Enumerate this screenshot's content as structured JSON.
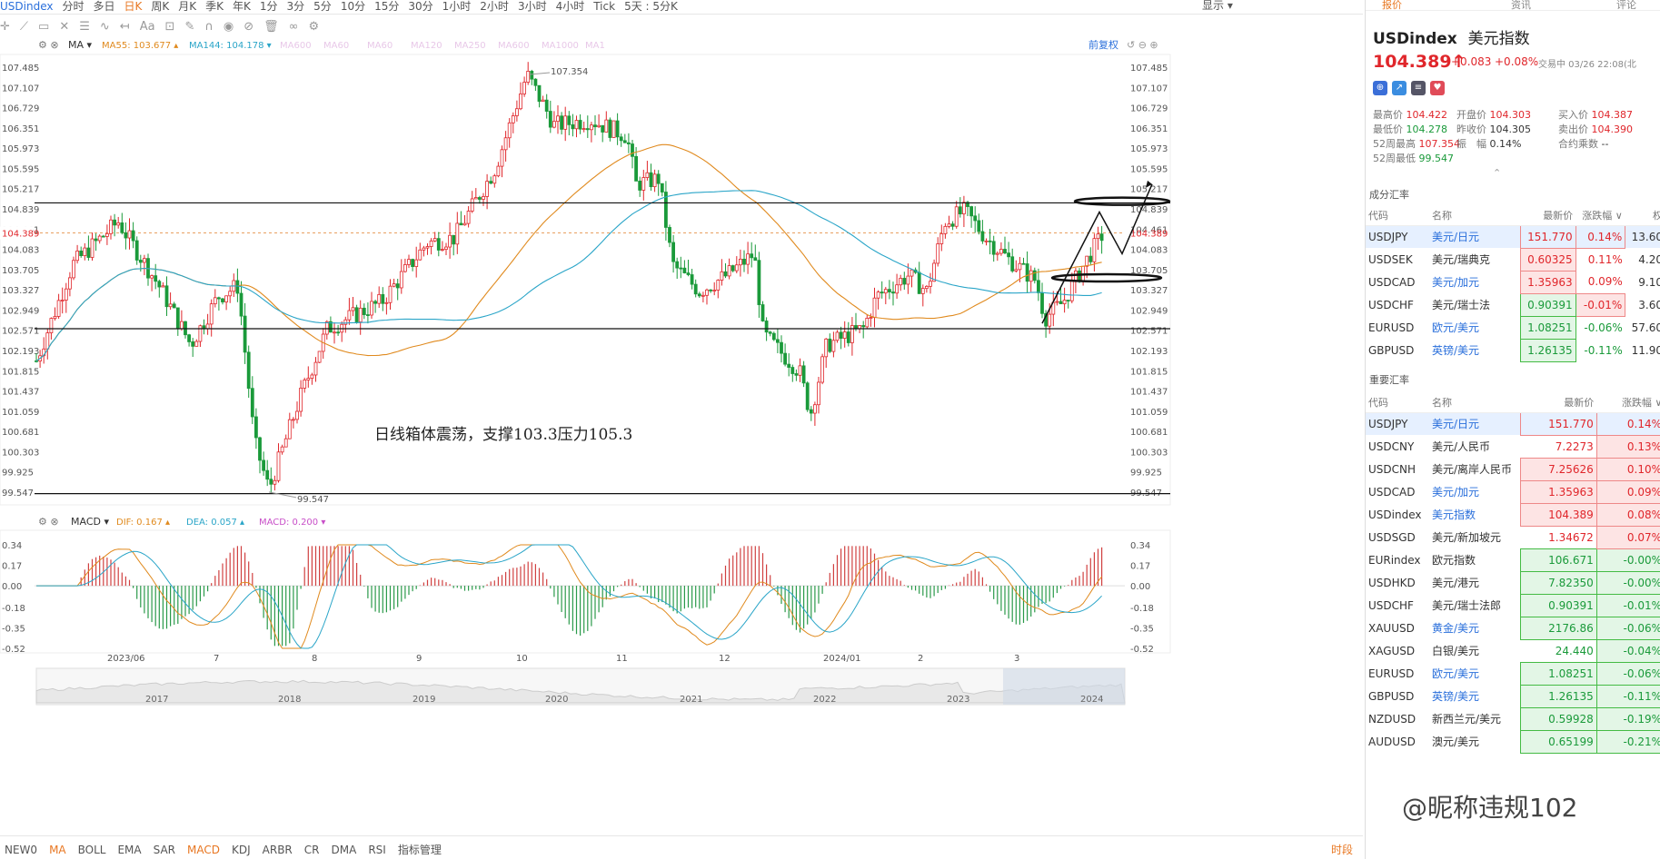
{
  "topbar": {
    "symbol": "USDindex",
    "periods": [
      "分时",
      "多日",
      "日K",
      "周K",
      "月K",
      "季K",
      "年K",
      "1分",
      "3分",
      "5分",
      "10分",
      "15分",
      "30分",
      "1小时",
      "2小时",
      "3小时",
      "4小时",
      "Tick",
      "5天 : 5分K"
    ],
    "active_period": "日K",
    "right": "显示"
  },
  "chart_header": {
    "ma_label": "MA",
    "ma55": "MA55: 103.677",
    "ma144": "MA144: 104.178",
    "faded": [
      "MA600",
      "MA60",
      "MA60",
      "MA120",
      "MA250",
      "MA600",
      "MA1000",
      "MA1"
    ],
    "fuquan": "前复权"
  },
  "macd_header": {
    "label": "MACD",
    "dif": "DIF: 0.167",
    "dea": "DEA: 0.057",
    "macd": "MACD: 0.200"
  },
  "price_axis": [
    "107.485",
    "107.107",
    "106.729",
    "106.351",
    "105.973",
    "105.595",
    "105.217",
    "104.839",
    "104.461",
    "104.083",
    "103.705",
    "103.327",
    "102.949",
    "102.571",
    "102.193",
    "101.815",
    "101.437",
    "101.059",
    "100.681",
    "100.303",
    "99.925",
    "99.547"
  ],
  "current_price": "104.389",
  "macd_axis": [
    "0.34",
    "0.17",
    "0.00",
    "-0.18",
    "-0.35",
    "-0.52"
  ],
  "x_labels": [
    "2023/06",
    "7",
    "8",
    "9",
    "10",
    "11",
    "12",
    "2024/01",
    "2",
    "3"
  ],
  "overview_years": [
    "2017",
    "2018",
    "2019",
    "2020",
    "2021",
    "2022",
    "2023",
    "2024"
  ],
  "high_label": "107.354",
  "low_label": "99.547",
  "annotation": "日线箱体震荡，支撑103.3压力105.3",
  "chart_data": {
    "type": "candlestick",
    "x_range": [
      "2023/05",
      "2024/03"
    ],
    "y_range": [
      99.547,
      107.485
    ],
    "high": 107.354,
    "low": 99.547,
    "current": 104.389,
    "horizontal_lines": [
      104.95,
      102.6,
      99.52
    ],
    "ma55_last": 103.677,
    "ma144_last": 104.178,
    "macd": {
      "dif": 0.167,
      "dea": 0.057,
      "macd": 0.2
    }
  },
  "bottom_indicators": [
    "NEW0",
    "MA",
    "BOLL",
    "EMA",
    "SAR",
    "MACD",
    "KDJ",
    "ARBR",
    "CR",
    "DMA",
    "RSI",
    "指标管理"
  ],
  "bottom_active": [
    "MA",
    "MACD"
  ],
  "bottom_right": "时段",
  "right_panel": {
    "tabs": [
      "报价",
      "资讯",
      "评论"
    ],
    "symbol": "USDindex",
    "name": "美元指数",
    "price": "104.389",
    "arrow": "↑",
    "change": "+0.083",
    "change_pct": "+0.08%",
    "status": "交易中 03/26 22:08(北",
    "stats": [
      {
        "k": "最高价",
        "v": "104.422"
      },
      {
        "k": "开盘价",
        "v": "104.303"
      },
      {
        "k": "买入价",
        "v": "104.387"
      },
      {
        "k": "最低价",
        "v": "104.278"
      },
      {
        "k": "昨收价",
        "v": "104.305"
      },
      {
        "k": "卖出价",
        "v": "104.390"
      },
      {
        "k": "52周最高",
        "v": "107.354"
      },
      {
        "k": "振　幅",
        "v": "0.14%"
      },
      {
        "k": "合约乘数",
        "v": "--"
      },
      {
        "k": "52周最低",
        "v": "99.547"
      }
    ],
    "sec1": "成分汇率",
    "head1": [
      "代码",
      "名称",
      "最新价",
      "涨跌幅",
      "权"
    ],
    "rows1": [
      {
        "code": "USDJPY",
        "name": "美元/日元",
        "price": "151.770",
        "pct": "0.14%",
        "w": "13.60"
      },
      {
        "code": "USDSEK",
        "name": "美元/瑞典克",
        "price": "0.60325",
        "pct": "0.11%",
        "w": "4.20"
      },
      {
        "code": "USDCAD",
        "name": "美元/加元",
        "price": "1.35963",
        "pct": "0.09%",
        "w": "9.10"
      },
      {
        "code": "USDCHF",
        "name": "美元/瑞士法",
        "price": "0.90391",
        "pct": "-0.01%",
        "w": "3.60"
      },
      {
        "code": "EURUSD",
        "name": "欧元/美元",
        "price": "1.08251",
        "pct": "-0.06%",
        "w": "57.60"
      },
      {
        "code": "GBPUSD",
        "name": "英镑/美元",
        "price": "1.26135",
        "pct": "-0.11%",
        "w": "11.90"
      }
    ],
    "sec2": "重要汇率",
    "head2": [
      "代码",
      "名称",
      "最新价",
      "涨跌幅"
    ],
    "rows2": [
      {
        "code": "USDJPY",
        "name": "美元/日元",
        "price": "151.770",
        "pct": "0.14%"
      },
      {
        "code": "USDCNY",
        "name": "美元/人民币",
        "price": "7.2273",
        "pct": "0.13%"
      },
      {
        "code": "USDCNH",
        "name": "美元/离岸人民币",
        "price": "7.25626",
        "pct": "0.10%"
      },
      {
        "code": "USDCAD",
        "name": "美元/加元",
        "price": "1.35963",
        "pct": "0.09%"
      },
      {
        "code": "USDindex",
        "name": "美元指数",
        "price": "104.389",
        "pct": "0.08%"
      },
      {
        "code": "USDSGD",
        "name": "美元/新加坡元",
        "price": "1.34672",
        "pct": "0.07%"
      },
      {
        "code": "EURindex",
        "name": "欧元指数",
        "price": "106.671",
        "pct": "-0.00%"
      },
      {
        "code": "USDHKD",
        "name": "美元/港元",
        "price": "7.82350",
        "pct": "-0.00%"
      },
      {
        "code": "USDCHF",
        "name": "美元/瑞士法郎",
        "price": "0.90391",
        "pct": "-0.01%"
      },
      {
        "code": "XAUUSD",
        "name": "黄金/美元",
        "price": "2176.86",
        "pct": "-0.06%"
      },
      {
        "code": "XAGUSD",
        "name": "白银/美元",
        "price": "24.440",
        "pct": "-0.04%"
      },
      {
        "code": "EURUSD",
        "name": "欧元/美元",
        "price": "1.08251",
        "pct": "-0.06%"
      },
      {
        "code": "GBPUSD",
        "name": "英镑/美元",
        "price": "1.26135",
        "pct": "-0.11%"
      },
      {
        "code": "NZDUSD",
        "name": "新西兰元/美元",
        "price": "0.59928",
        "pct": "-0.19%"
      },
      {
        "code": "AUDUSD",
        "name": "澳元/美元",
        "price": "0.65199",
        "pct": "-0.21%"
      }
    ]
  },
  "watermark": "@昵称违规102"
}
